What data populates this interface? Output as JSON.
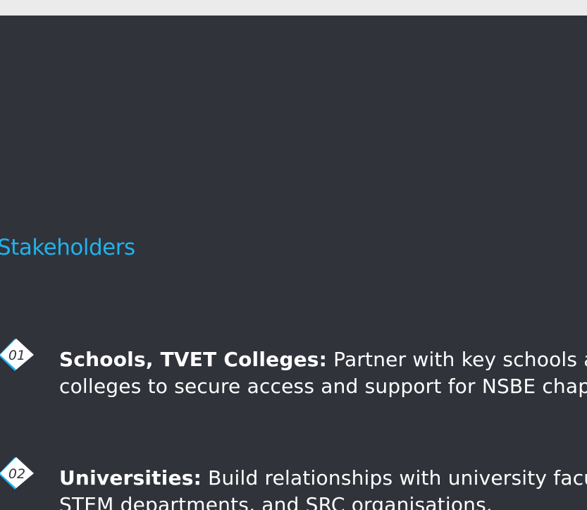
{
  "slide": {
    "heading": "Stakeholders",
    "items": [
      {
        "number": "01",
        "label": "Schools, TVET Colleges:",
        "text_line1": " Partner with key schools and",
        "text_line2": "colleges to secure access and support for NSBE chapters."
      },
      {
        "number": "02",
        "label": "Universities:",
        "text_line1": " Build relationships with university faculties,",
        "text_line2": "STEM departments, and SRC organisations."
      }
    ]
  },
  "colors": {
    "background": "#30333a",
    "accent": "#1fb3ec",
    "text": "#ffffff"
  }
}
